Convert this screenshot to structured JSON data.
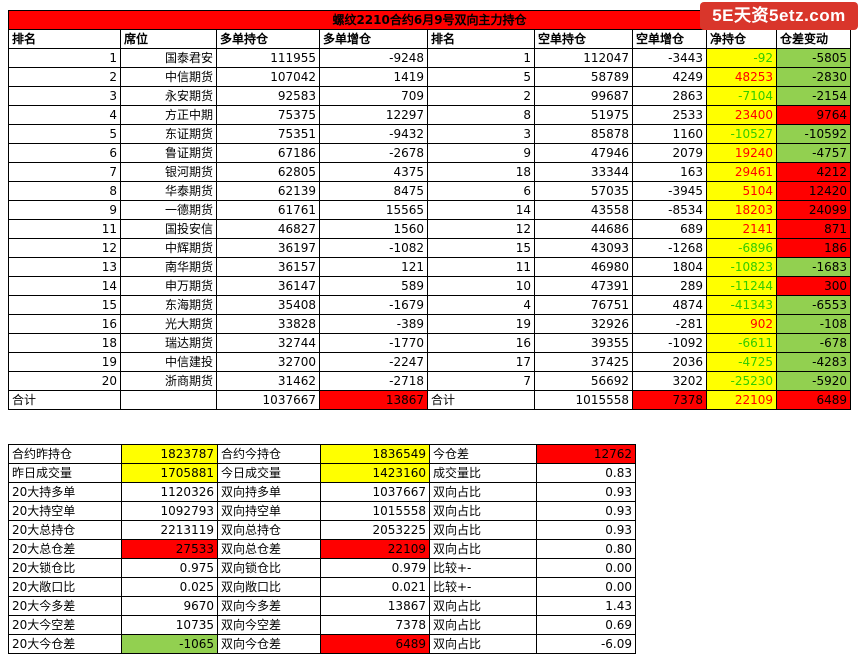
{
  "title": "螺纹2210合约6月9号双向主力持仓",
  "logo": "5E天资5etz.com",
  "headers": [
    "排名",
    "席位",
    "多单持仓",
    "多单增仓",
    "排名",
    "空单持仓",
    "空单增仓",
    "净持仓",
    "仓差变动"
  ],
  "rows": [
    {
      "rank": "1",
      "seat": "国泰君安",
      "long": "111955",
      "long_chg": "-9248",
      "srank": "1",
      "short": "112047",
      "short_chg": "-3443",
      "net": "-92",
      "diff": "-5805"
    },
    {
      "rank": "2",
      "seat": "中信期货",
      "long": "107042",
      "long_chg": "1419",
      "srank": "5",
      "short": "58789",
      "short_chg": "4249",
      "net": "48253",
      "diff": "-2830"
    },
    {
      "rank": "3",
      "seat": "永安期货",
      "long": "92583",
      "long_chg": "709",
      "srank": "2",
      "short": "99687",
      "short_chg": "2863",
      "net": "-7104",
      "diff": "-2154"
    },
    {
      "rank": "4",
      "seat": "方正中期",
      "long": "75375",
      "long_chg": "12297",
      "srank": "8",
      "short": "51975",
      "short_chg": "2533",
      "net": "23400",
      "diff": "9764"
    },
    {
      "rank": "5",
      "seat": "东证期货",
      "long": "75351",
      "long_chg": "-9432",
      "srank": "3",
      "short": "85878",
      "short_chg": "1160",
      "net": "-10527",
      "diff": "-10592"
    },
    {
      "rank": "6",
      "seat": "鲁证期货",
      "long": "67186",
      "long_chg": "-2678",
      "srank": "9",
      "short": "47946",
      "short_chg": "2079",
      "net": "19240",
      "diff": "-4757"
    },
    {
      "rank": "7",
      "seat": "银河期货",
      "long": "62805",
      "long_chg": "4375",
      "srank": "18",
      "short": "33344",
      "short_chg": "163",
      "net": "29461",
      "diff": "4212"
    },
    {
      "rank": "8",
      "seat": "华泰期货",
      "long": "62139",
      "long_chg": "8475",
      "srank": "6",
      "short": "57035",
      "short_chg": "-3945",
      "net": "5104",
      "diff": "12420"
    },
    {
      "rank": "9",
      "seat": "一德期货",
      "long": "61761",
      "long_chg": "15565",
      "srank": "14",
      "short": "43558",
      "short_chg": "-8534",
      "net": "18203",
      "diff": "24099"
    },
    {
      "rank": "11",
      "seat": "国投安信",
      "long": "46827",
      "long_chg": "1560",
      "srank": "12",
      "short": "44686",
      "short_chg": "689",
      "net": "2141",
      "diff": "871"
    },
    {
      "rank": "12",
      "seat": "中辉期货",
      "long": "36197",
      "long_chg": "-1082",
      "srank": "15",
      "short": "43093",
      "short_chg": "-1268",
      "net": "-6896",
      "diff": "186"
    },
    {
      "rank": "13",
      "seat": "南华期货",
      "long": "36157",
      "long_chg": "121",
      "srank": "11",
      "short": "46980",
      "short_chg": "1804",
      "net": "-10823",
      "diff": "-1683"
    },
    {
      "rank": "14",
      "seat": "申万期货",
      "long": "36147",
      "long_chg": "589",
      "srank": "10",
      "short": "47391",
      "short_chg": "289",
      "net": "-11244",
      "diff": "300"
    },
    {
      "rank": "15",
      "seat": "东海期货",
      "long": "35408",
      "long_chg": "-1679",
      "srank": "4",
      "short": "76751",
      "short_chg": "4874",
      "net": "-41343",
      "diff": "-6553"
    },
    {
      "rank": "16",
      "seat": "光大期货",
      "long": "33828",
      "long_chg": "-389",
      "srank": "19",
      "short": "32926",
      "short_chg": "-281",
      "net": "902",
      "diff": "-108"
    },
    {
      "rank": "18",
      "seat": "瑞达期货",
      "long": "32744",
      "long_chg": "-1770",
      "srank": "16",
      "short": "39355",
      "short_chg": "-1092",
      "net": "-6611",
      "diff": "-678"
    },
    {
      "rank": "19",
      "seat": "中信建投",
      "long": "32700",
      "long_chg": "-2247",
      "srank": "17",
      "short": "37425",
      "short_chg": "2036",
      "net": "-4725",
      "diff": "-4283"
    },
    {
      "rank": "20",
      "seat": "浙商期货",
      "long": "31462",
      "long_chg": "-2718",
      "srank": "7",
      "short": "56692",
      "short_chg": "3202",
      "net": "-25230",
      "diff": "-5920"
    }
  ],
  "total": {
    "label": "合计",
    "long": "1037667",
    "long_chg": "13867",
    "label2": "合计",
    "short": "1015558",
    "short_chg": "7378",
    "net": "22109",
    "diff": "6489"
  },
  "summary": [
    {
      "k1": "合约昨持仓",
      "v1": "1823787",
      "c1": "y",
      "k2": "合约今持仓",
      "v2": "1836549",
      "c2": "y",
      "k3": "今仓差",
      "v3": "12762",
      "c3": "rd"
    },
    {
      "k1": "昨日成交量",
      "v1": "1705881",
      "c1": "y",
      "k2": "今日成交量",
      "v2": "1423160",
      "c2": "y",
      "k3": "成交量比",
      "v3": "0.83",
      "c3": ""
    },
    {
      "k1": "20大持多单",
      "v1": "1120326",
      "c1": "",
      "k2": "双向持多单",
      "v2": "1037667",
      "c2": "",
      "k3": "双向占比",
      "v3": "0.93",
      "c3": ""
    },
    {
      "k1": "20大持空单",
      "v1": "1092793",
      "c1": "",
      "k2": "双向持空单",
      "v2": "1015558",
      "c2": "",
      "k3": "双向占比",
      "v3": "0.93",
      "c3": ""
    },
    {
      "k1": "20大总持仓",
      "v1": "2213119",
      "c1": "",
      "k2": "双向总持仓",
      "v2": "2053225",
      "c2": "",
      "k3": "双向占比",
      "v3": "0.93",
      "c3": ""
    },
    {
      "k1": "20大总仓差",
      "v1": "27533",
      "c1": "rd",
      "k2": "双向总仓差",
      "v2": "22109",
      "c2": "rd",
      "k3": "双向占比",
      "v3": "0.80",
      "c3": ""
    },
    {
      "k1": "20大锁仓比",
      "v1": "0.975",
      "c1": "",
      "k2": "双向锁仓比",
      "v2": "0.979",
      "c2": "",
      "k3": "比较+-",
      "v3": "0.00",
      "c3": ""
    },
    {
      "k1": "20大敞口比",
      "v1": "0.025",
      "c1": "",
      "k2": "双向敞口比",
      "v2": "0.021",
      "c2": "",
      "k3": "比较+-",
      "v3": "0.00",
      "c3": ""
    },
    {
      "k1": "20大今多差",
      "v1": "9670",
      "c1": "",
      "k2": "双向今多差",
      "v2": "13867",
      "c2": "",
      "k3": "双向占比",
      "v3": "1.43",
      "c3": ""
    },
    {
      "k1": "20大今空差",
      "v1": "10735",
      "c1": "",
      "k2": "双向今空差",
      "v2": "7378",
      "c2": "",
      "k3": "双向占比",
      "v3": "0.69",
      "c3": ""
    },
    {
      "k1": "20大今仓差",
      "v1": "-1065",
      "c1": "g",
      "k2": "双向今仓差",
      "v2": "6489",
      "c2": "rd",
      "k3": "双向占比",
      "v3": "-6.09",
      "c3": ""
    }
  ],
  "colors": {
    "yellow": "#ffff00",
    "red": "#ff0000",
    "green": "#92d050",
    "neg_text": "#33cc00",
    "pos_text": "#ff0000"
  }
}
